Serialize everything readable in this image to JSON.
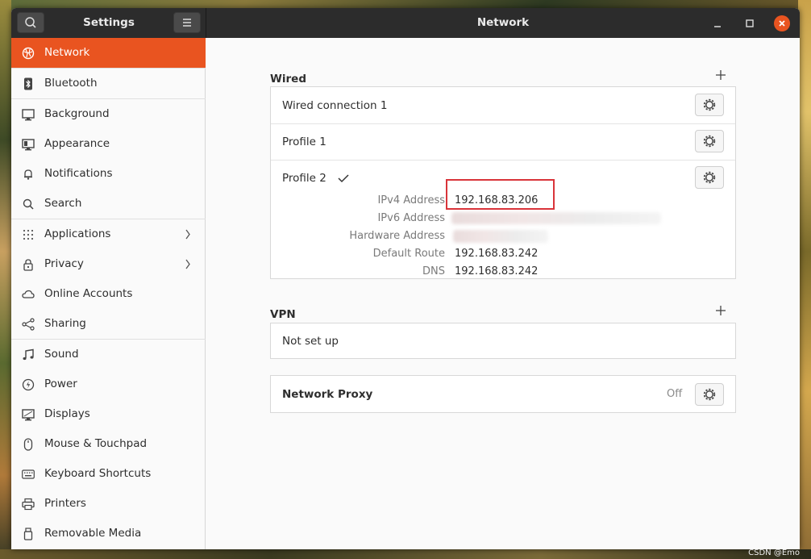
{
  "window": {
    "sidebar_title": "Settings",
    "main_title": "Network",
    "accent": "#e95420"
  },
  "sidebar": {
    "items": [
      {
        "label": "Network",
        "icon": "network-icon",
        "active": true
      },
      {
        "label": "Bluetooth",
        "icon": "bluetooth-icon"
      },
      {
        "label": "Background",
        "icon": "background-icon"
      },
      {
        "label": "Appearance",
        "icon": "appearance-icon"
      },
      {
        "label": "Notifications",
        "icon": "bell-icon"
      },
      {
        "label": "Search",
        "icon": "search-icon"
      },
      {
        "label": "Applications",
        "icon": "grid-icon",
        "chevron": true
      },
      {
        "label": "Privacy",
        "icon": "lock-icon",
        "chevron": true
      },
      {
        "label": "Online Accounts",
        "icon": "cloud-icon"
      },
      {
        "label": "Sharing",
        "icon": "share-icon"
      },
      {
        "label": "Sound",
        "icon": "music-note-icon"
      },
      {
        "label": "Power",
        "icon": "power-icon"
      },
      {
        "label": "Displays",
        "icon": "display-icon"
      },
      {
        "label": "Mouse & Touchpad",
        "icon": "mouse-icon"
      },
      {
        "label": "Keyboard Shortcuts",
        "icon": "keyboard-icon"
      },
      {
        "label": "Printers",
        "icon": "printer-icon"
      },
      {
        "label": "Removable Media",
        "icon": "usb-icon"
      }
    ]
  },
  "wired": {
    "title": "Wired",
    "connections": [
      {
        "name": "Wired connection 1"
      },
      {
        "name": "Profile 1"
      },
      {
        "name": "Profile 2",
        "checked": true
      }
    ],
    "details": [
      {
        "key": "IPv4 Address",
        "value": "192.168.83.206"
      },
      {
        "key": "IPv6 Address",
        "value": ""
      },
      {
        "key": "Hardware Address",
        "value": ""
      },
      {
        "key": "Default Route",
        "value": "192.168.83.242"
      },
      {
        "key": "DNS",
        "value": "192.168.83.242"
      }
    ]
  },
  "vpn": {
    "title": "VPN",
    "empty_label": "Not set up"
  },
  "proxy": {
    "label": "Network Proxy",
    "status": "Off"
  },
  "watermark": "CSDN @Emo"
}
